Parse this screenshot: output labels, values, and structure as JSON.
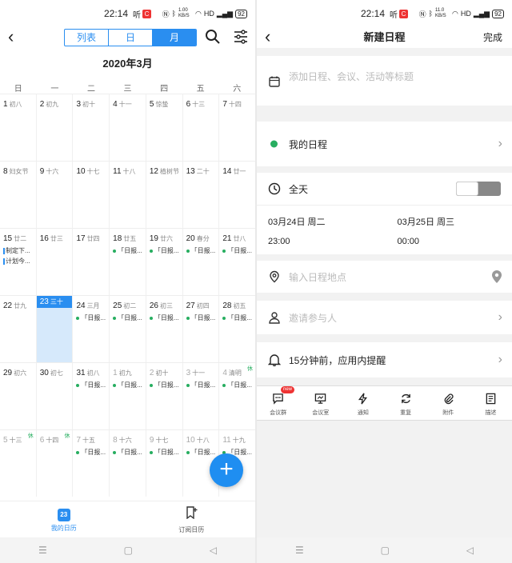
{
  "status_bar": {
    "time": "22:14",
    "left_icon": "听",
    "net_speed_left": "1.00 KB/S",
    "net_speed_right": "11.0 KB/S",
    "battery": "92",
    "hd": "HD"
  },
  "calendar": {
    "back_icon": "back-arrow-icon",
    "view_tabs": [
      {
        "label": "列表"
      },
      {
        "label": "日"
      },
      {
        "label": "月"
      }
    ],
    "month_title": "2020年3月",
    "weekdays": [
      "日",
      "一",
      "二",
      "三",
      "四",
      "五",
      "六"
    ],
    "weeks": [
      [
        {
          "d": "1",
          "l": "初八"
        },
        {
          "d": "2",
          "l": "初九"
        },
        {
          "d": "3",
          "l": "初十"
        },
        {
          "d": "4",
          "l": "十一"
        },
        {
          "d": "5",
          "l": "惊蛰"
        },
        {
          "d": "6",
          "l": "十三"
        },
        {
          "d": "7",
          "l": "十四"
        }
      ],
      [
        {
          "d": "8",
          "l": "妇女节"
        },
        {
          "d": "9",
          "l": "十六"
        },
        {
          "d": "10",
          "l": "十七"
        },
        {
          "d": "11",
          "l": "十八"
        },
        {
          "d": "12",
          "l": "植树节"
        },
        {
          "d": "13",
          "l": "二十"
        },
        {
          "d": "14",
          "l": "廿一"
        }
      ],
      [
        {
          "d": "15",
          "l": "廿二",
          "ev": [
            "制定下...",
            "计划今..."
          ],
          "evtype": "bar"
        },
        {
          "d": "16",
          "l": "廿三"
        },
        {
          "d": "17",
          "l": "廿四"
        },
        {
          "d": "18",
          "l": "廿五",
          "ev": [
            "「日报..."
          ]
        },
        {
          "d": "19",
          "l": "廿六",
          "ev": [
            "「日报..."
          ]
        },
        {
          "d": "20",
          "l": "春分",
          "ev": [
            "「日报..."
          ]
        },
        {
          "d": "21",
          "l": "廿八",
          "ev": [
            "「日报..."
          ]
        }
      ],
      [
        {
          "d": "22",
          "l": "廿九"
        },
        {
          "d": "23",
          "l": "三十",
          "today": true
        },
        {
          "d": "24",
          "l": "三月",
          "ev": [
            "「日报..."
          ]
        },
        {
          "d": "25",
          "l": "初二",
          "ev": [
            "「日报..."
          ]
        },
        {
          "d": "26",
          "l": "初三",
          "ev": [
            "「日报..."
          ]
        },
        {
          "d": "27",
          "l": "初四",
          "ev": [
            "「日报..."
          ]
        },
        {
          "d": "28",
          "l": "初五",
          "ev": [
            "「日报..."
          ]
        }
      ],
      [
        {
          "d": "29",
          "l": "初六"
        },
        {
          "d": "30",
          "l": "初七"
        },
        {
          "d": "31",
          "l": "初八",
          "ev": [
            "「日报..."
          ]
        },
        {
          "d": "1",
          "l": "初九",
          "other": true,
          "ev": [
            "「日报..."
          ]
        },
        {
          "d": "2",
          "l": "初十",
          "other": true,
          "ev": [
            "「日报..."
          ]
        },
        {
          "d": "3",
          "l": "十一",
          "other": true,
          "ev": [
            "「日报..."
          ]
        },
        {
          "d": "4",
          "l": "清明",
          "other": true,
          "xiu": "休",
          "ev": [
            "「日报..."
          ]
        }
      ],
      [
        {
          "d": "5",
          "l": "十三",
          "other": true,
          "xiu": "休"
        },
        {
          "d": "6",
          "l": "十四",
          "other": true,
          "xiu": "休"
        },
        {
          "d": "7",
          "l": "十五",
          "other": true,
          "ev": [
            "「日报..."
          ]
        },
        {
          "d": "8",
          "l": "十六",
          "other": true,
          "ev": [
            "「日报..."
          ]
        },
        {
          "d": "9",
          "l": "十七",
          "other": true,
          "ev": [
            "「日报..."
          ]
        },
        {
          "d": "10",
          "l": "十八",
          "other": true,
          "ev": [
            "「日报..."
          ]
        },
        {
          "d": "11",
          "l": "十九",
          "other": true,
          "ev": [
            "「日报..."
          ]
        }
      ]
    ],
    "fab_label": "+",
    "bottom_nav": {
      "my_calendar_badge": "23",
      "my_calendar": "我的日历",
      "subscribe": "订阅日历"
    }
  },
  "new_event": {
    "title": "新建日程",
    "done": "完成",
    "title_placeholder": "添加日程、会议、活动等标题",
    "calendar_name": "我的日程",
    "all_day": "全天",
    "start_date": "03月24日 周二",
    "start_time": "23:00",
    "end_date": "03月25日 周三",
    "end_time": "00:00",
    "location_placeholder": "输入日程地点",
    "invite_placeholder": "邀请参与人",
    "reminder": "15分钟前，应用内提醒",
    "tools": [
      {
        "label": "会议群",
        "icon": "chat-icon",
        "badge": "new"
      },
      {
        "label": "会议室",
        "icon": "screen-icon"
      },
      {
        "label": "通知",
        "icon": "lightning-icon"
      },
      {
        "label": "重复",
        "icon": "repeat-icon"
      },
      {
        "label": "附件",
        "icon": "paperclip-icon"
      },
      {
        "label": "描述",
        "icon": "document-icon"
      }
    ]
  },
  "colors": {
    "accent": "#2a8ef0",
    "event_dot": "#27ae60",
    "today_bg": "#d6e9fb"
  }
}
